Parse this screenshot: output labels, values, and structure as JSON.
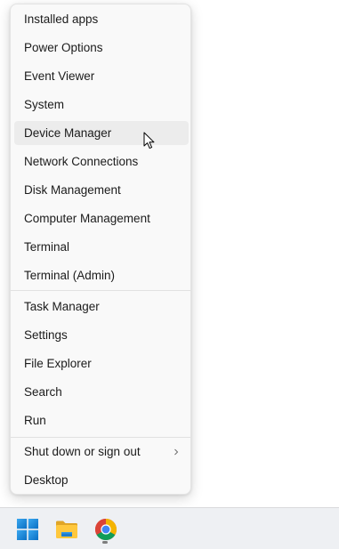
{
  "menu": {
    "groups": [
      {
        "items": [
          {
            "label": "Installed apps"
          },
          {
            "label": "Power Options"
          },
          {
            "label": "Event Viewer"
          },
          {
            "label": "System"
          },
          {
            "label": "Device Manager",
            "hovered": true
          },
          {
            "label": "Network Connections"
          },
          {
            "label": "Disk Management"
          },
          {
            "label": "Computer Management"
          },
          {
            "label": "Terminal"
          },
          {
            "label": "Terminal (Admin)"
          }
        ]
      },
      {
        "items": [
          {
            "label": "Task Manager"
          },
          {
            "label": "Settings"
          },
          {
            "label": "File Explorer"
          },
          {
            "label": "Search"
          },
          {
            "label": "Run"
          }
        ]
      },
      {
        "items": [
          {
            "label": "Shut down or sign out",
            "has_submenu": true,
            "submenu_icon": "chevron-right-icon"
          },
          {
            "label": "Desktop"
          }
        ]
      }
    ]
  },
  "taskbar": {
    "icons": [
      {
        "icon": "windows-start-icon"
      },
      {
        "icon": "file-explorer-icon"
      },
      {
        "icon": "chrome-icon",
        "running": true
      }
    ]
  },
  "colors": {
    "menu_bg": "#f9f9f9",
    "hover_bg": "#ececec",
    "text": "#1b1b1b",
    "taskbar_bg": "#eef0f3",
    "windows_blue": "#0a78d4"
  }
}
